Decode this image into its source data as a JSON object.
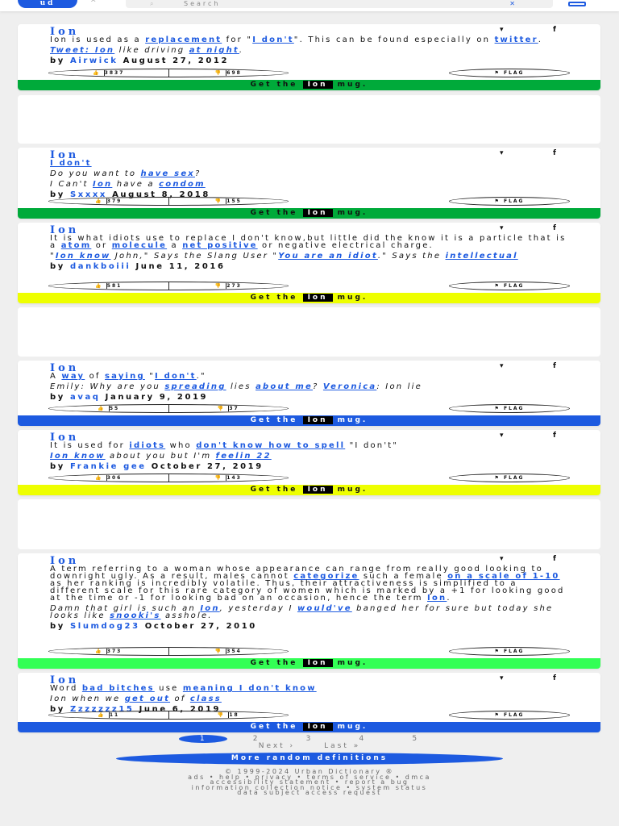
{
  "header": {
    "logo": "ud",
    "search_placeholder": "Search"
  },
  "mug": {
    "prefix": "Get the",
    "suffix": "mug."
  },
  "flag_label": "FLAG",
  "entries": [
    {
      "word": "Ion",
      "meaning": [
        {
          "t": "Ion is used as a "
        },
        {
          "t": "replacement",
          "l": 1
        },
        {
          "t": " for \""
        },
        {
          "t": "I don't",
          "l": 1
        },
        {
          "t": "\". This can be found especially on "
        },
        {
          "t": "twitter",
          "l": 1
        },
        {
          "t": "."
        }
      ],
      "example": [
        {
          "t": "Tweet: Ion",
          "l": 1
        },
        {
          "t": " like driving "
        },
        {
          "t": "at night",
          "l": 1
        },
        {
          "t": "."
        }
      ],
      "author": "Airwick",
      "date": "August 27, 2012",
      "up": "3837",
      "down": "698",
      "mug_color": "#00aa3a",
      "mug_text": "#111"
    },
    {
      "word": "Ion",
      "meaning": [
        {
          "t": "I don't",
          "l": 1
        }
      ],
      "example": [
        {
          "t": "Do you want to "
        },
        {
          "t": "have sex",
          "l": 1
        },
        {
          "t": "?"
        }
      ],
      "example2": [
        {
          "t": "I Can't "
        },
        {
          "t": "Ion",
          "l": 1
        },
        {
          "t": " have a "
        },
        {
          "t": "condom",
          "l": 1
        }
      ],
      "author": "Sxxxx",
      "date": "August 8, 2018",
      "up": "379",
      "down": "155",
      "mug_color": "#00aa3a",
      "mug_text": "#111"
    },
    {
      "word": "Ion",
      "meaning": [
        {
          "t": "It is what idiots use to replace I don't know,but little did the know it is a particle that is a "
        },
        {
          "t": "atom",
          "l": 1
        },
        {
          "t": " or "
        },
        {
          "t": "molecule",
          "l": 1
        },
        {
          "t": " a "
        },
        {
          "t": "net positive",
          "l": 1
        },
        {
          "t": " or negative electrical charge."
        }
      ],
      "example": [
        {
          "t": "\""
        },
        {
          "t": "Ion know",
          "l": 1
        },
        {
          "t": " John,\" Says the Slang User \""
        },
        {
          "t": "You are an idiot",
          "l": 1
        },
        {
          "t": ".\" Says the "
        },
        {
          "t": "intellectual",
          "l": 1
        }
      ],
      "author": "dankboiii",
      "date": "June 11, 2016",
      "up": "581",
      "down": "273",
      "mug_color": "#eeff00",
      "mug_text": "#111"
    },
    {
      "word": "Ion",
      "meaning": [
        {
          "t": "A "
        },
        {
          "t": "way",
          "l": 1
        },
        {
          "t": " of "
        },
        {
          "t": "saying",
          "l": 1
        },
        {
          "t": " \""
        },
        {
          "t": "I don't",
          "l": 1
        },
        {
          "t": ".\""
        }
      ],
      "example": [
        {
          "t": "Emily: Why are you "
        },
        {
          "t": "spreading",
          "l": 1
        },
        {
          "t": " lies "
        },
        {
          "t": "about me",
          "l": 1
        },
        {
          "t": "? "
        },
        {
          "t": "Veronica",
          "l": 1
        },
        {
          "t": ": Ion lie"
        }
      ],
      "author": "avaq",
      "date": "January 9, 2019",
      "up": "55",
      "down": "37",
      "mug_color": "#1d5ae0",
      "mug_text": "#fff"
    },
    {
      "word": "Ion",
      "meaning": [
        {
          "t": "It is used for "
        },
        {
          "t": "idiots",
          "l": 1
        },
        {
          "t": " who "
        },
        {
          "t": "don't know how to spell",
          "l": 1
        },
        {
          "t": " \"I don't\""
        }
      ],
      "example": [
        {
          "t": "Ion know",
          "l": 1
        },
        {
          "t": " about you but I'm "
        },
        {
          "t": "feelin 22",
          "l": 1
        }
      ],
      "author": "Frankie gee",
      "date": "October 27, 2019",
      "up": "306",
      "down": "143",
      "mug_color": "#eeff00",
      "mug_text": "#111"
    },
    {
      "word": "Ion",
      "meaning": [
        {
          "t": "A term referring to a woman whose appearance can range from really good looking to downright ugly. As a result, males cannot "
        },
        {
          "t": "categorize",
          "l": 1
        },
        {
          "t": " such a female "
        },
        {
          "t": "on a scale of 1-10",
          "l": 1
        },
        {
          "t": " as her ranking is incredibly volatile. Thus, their attractiveness is simplified to a different scale for this rare category of women which is marked by a +1 for looking good at the time or -1 for looking bad on an occasion, hence the term "
        },
        {
          "t": "Ion",
          "l": 1
        },
        {
          "t": "."
        }
      ],
      "example": [
        {
          "t": "Damn that girl is such an "
        },
        {
          "t": "Ion",
          "l": 1
        },
        {
          "t": ", yesterday I "
        },
        {
          "t": "would've",
          "l": 1
        },
        {
          "t": " banged her for sure but today she looks like "
        },
        {
          "t": "snooki's",
          "l": 1
        },
        {
          "t": " asshole."
        }
      ],
      "author": "Slumdog23",
      "date": "October 27, 2010",
      "up": "373",
      "down": "354",
      "mug_color": "#33ff55",
      "mug_text": "#111"
    },
    {
      "word": "Ion",
      "meaning": [
        {
          "t": "Word "
        },
        {
          "t": "bad bitches",
          "l": 1
        },
        {
          "t": " use "
        },
        {
          "t": "meaning I don't know",
          "l": 1
        }
      ],
      "example": [
        {
          "t": "Ion when we "
        },
        {
          "t": "get out",
          "l": 1
        },
        {
          "t": " of "
        },
        {
          "t": "class",
          "l": 1
        }
      ],
      "author": "Zzzzzzz15",
      "date": "June 6, 2019",
      "up": "11",
      "down": "18",
      "mug_color": "#1d5ae0",
      "mug_text": "#fff"
    }
  ],
  "pagination": {
    "pages": [
      "1",
      "2",
      "3",
      "4",
      "5"
    ],
    "next": "Next ›",
    "last": "Last »"
  },
  "more_button": "More random definitions",
  "footer": [
    "© 1999-2024 Urban Dictionary ®",
    "ads • help • privacy • terms of service • dmca",
    "accessibility statement • report a bug",
    "information collection notice • system status",
    "data subject access request"
  ],
  "by_label": "by"
}
